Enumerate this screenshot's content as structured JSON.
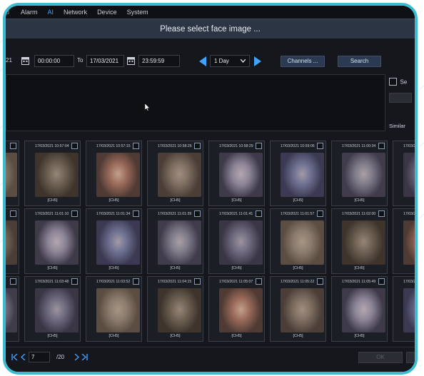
{
  "nav": {
    "items": [
      {
        "label": "d",
        "active": false
      },
      {
        "label": "Alarm",
        "active": false
      },
      {
        "label": "AI",
        "active": true
      },
      {
        "label": "Network",
        "active": false
      },
      {
        "label": "Device",
        "active": false
      },
      {
        "label": "System",
        "active": false
      }
    ]
  },
  "dialog": {
    "title": "Please select face image ..."
  },
  "search": {
    "start_date": "21",
    "start_time": "00:00:00",
    "to_label": "To",
    "end_date": "17/03/2021",
    "end_time": "23:59:59",
    "period": "1 Day",
    "channels_label": "Channels ...",
    "search_label": "Search"
  },
  "right_panel": {
    "select_label": "Se",
    "similarity_label": "Similar"
  },
  "results": {
    "rows": [
      [
        {
          "time": "",
          "channel": ""
        },
        {
          "time": "17/03/2021 10:57:04",
          "channel": "[CH5]"
        },
        {
          "time": "17/03/2021 10:57:15",
          "channel": "[CH5]"
        },
        {
          "time": "17/03/2021 10:58:26",
          "channel": "[CH5]"
        },
        {
          "time": "17/03/2021 10:58:29",
          "channel": "[CH5]"
        },
        {
          "time": "17/03/2021 10:59:06",
          "channel": "[CH5]"
        },
        {
          "time": "17/03/2021 11:00:34",
          "channel": "[CH5]"
        },
        {
          "time": "17/03/20",
          "channel": ""
        }
      ],
      [
        {
          "time": "",
          "channel": ""
        },
        {
          "time": "17/03/2021 11:01:10",
          "channel": "[CH5]"
        },
        {
          "time": "17/03/2021 11:01:34",
          "channel": "[CH5]"
        },
        {
          "time": "17/03/2021 11:01:39",
          "channel": "[CH5]"
        },
        {
          "time": "17/03/2021 11:01:41",
          "channel": "[CH5]"
        },
        {
          "time": "17/03/2021 11:01:57",
          "channel": "[CH5]"
        },
        {
          "time": "17/03/2021 11:02:00",
          "channel": "[CH5]"
        },
        {
          "time": "17/03/20",
          "channel": ""
        }
      ],
      [
        {
          "time": "",
          "channel": ""
        },
        {
          "time": "17/03/2021 11:03:48",
          "channel": "[CH5]"
        },
        {
          "time": "17/03/2021 11:03:52",
          "channel": "[CH5]"
        },
        {
          "time": "17/03/2021 11:04:15",
          "channel": "[CH5]"
        },
        {
          "time": "17/03/2021 11:05:07",
          "channel": "[CH5]"
        },
        {
          "time": "17/03/2021 11:05:22",
          "channel": "[CH5]"
        },
        {
          "time": "17/03/2021 11:05:49",
          "channel": "[CH5]"
        },
        {
          "time": "17/03/20",
          "channel": ""
        }
      ]
    ]
  },
  "pagination": {
    "first_icon": "first-page-icon",
    "prev_icon": "prev-page-icon",
    "current_page": "7",
    "total": "/20",
    "next_icon": "next-page-icon",
    "last_icon": "last-page-icon"
  },
  "footer": {
    "ok_label": "OK"
  },
  "colors": {
    "accent": "#3fa3ff",
    "frame": "#3bbcd0",
    "title_bar": "#2b3544"
  }
}
